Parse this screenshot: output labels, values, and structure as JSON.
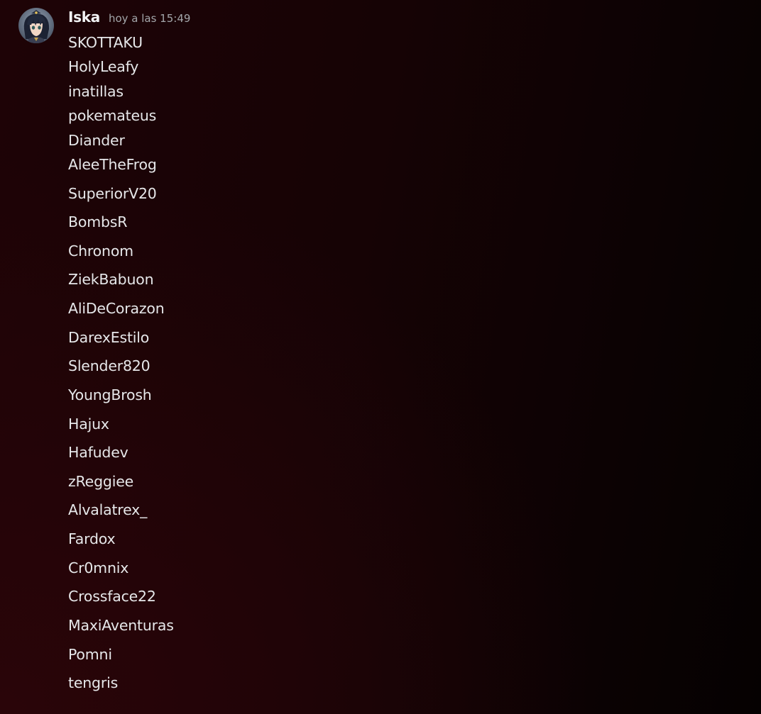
{
  "message": {
    "author": "Iska",
    "timestamp": "hoy a las 15:49",
    "avatar_icon": "anime-character-avatar",
    "lines": [
      "SKOTTAKU",
      "HolyLeafy",
      "inatillas",
      "pokemateus",
      "Diander",
      "AleeTheFrog",
      "SuperiorV20",
      "BombsR",
      "Chronom",
      "ZiekBabuon",
      "AliDeCorazon",
      "DarexEstilo",
      "Slender820",
      "YoungBrosh",
      "Hajux",
      "Hafudev",
      "zReggiee",
      "Alvalatrex_",
      "Fardox",
      "Cr0mnix",
      "Crossface22",
      "MaxiAventuras",
      "Pomni",
      "tengris"
    ]
  },
  "colors": {
    "background": "#140305",
    "username": "#f2f3f5",
    "timestamp": "#a3a6aa",
    "text": "#e6e7e9"
  }
}
